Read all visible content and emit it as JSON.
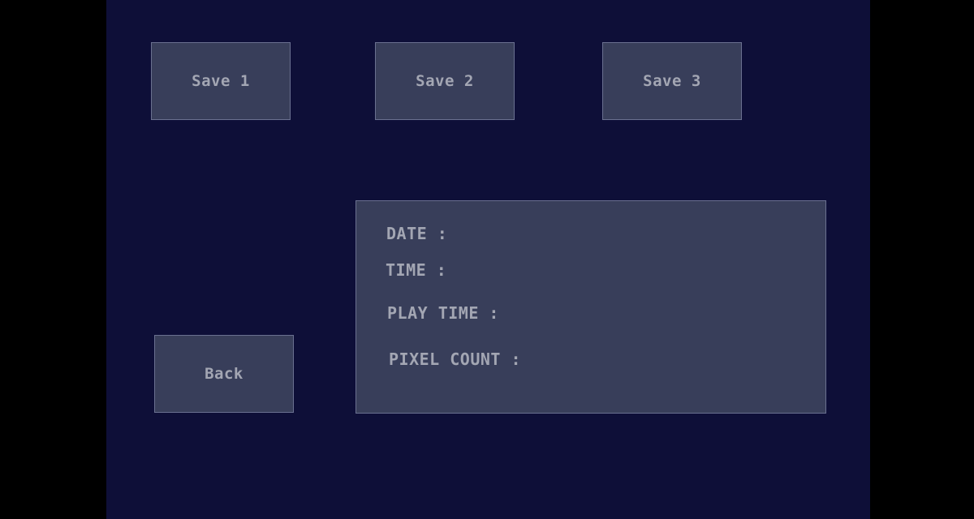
{
  "save_slots": [
    {
      "label": "Save 1"
    },
    {
      "label": "Save 2"
    },
    {
      "label": "Save 3"
    }
  ],
  "back_label": "Back",
  "info_panel": {
    "date_label": "DATE :",
    "time_label": "TIME :",
    "play_time_label": "PLAY TIME :",
    "pixel_count_label": "PIXEL COUNT :"
  },
  "colors": {
    "outer_background": "#000000",
    "stage_background": "#0e0f38",
    "panel_fill": "#383e5a",
    "panel_border": "#6a7090",
    "text": "#a3a6b3"
  }
}
